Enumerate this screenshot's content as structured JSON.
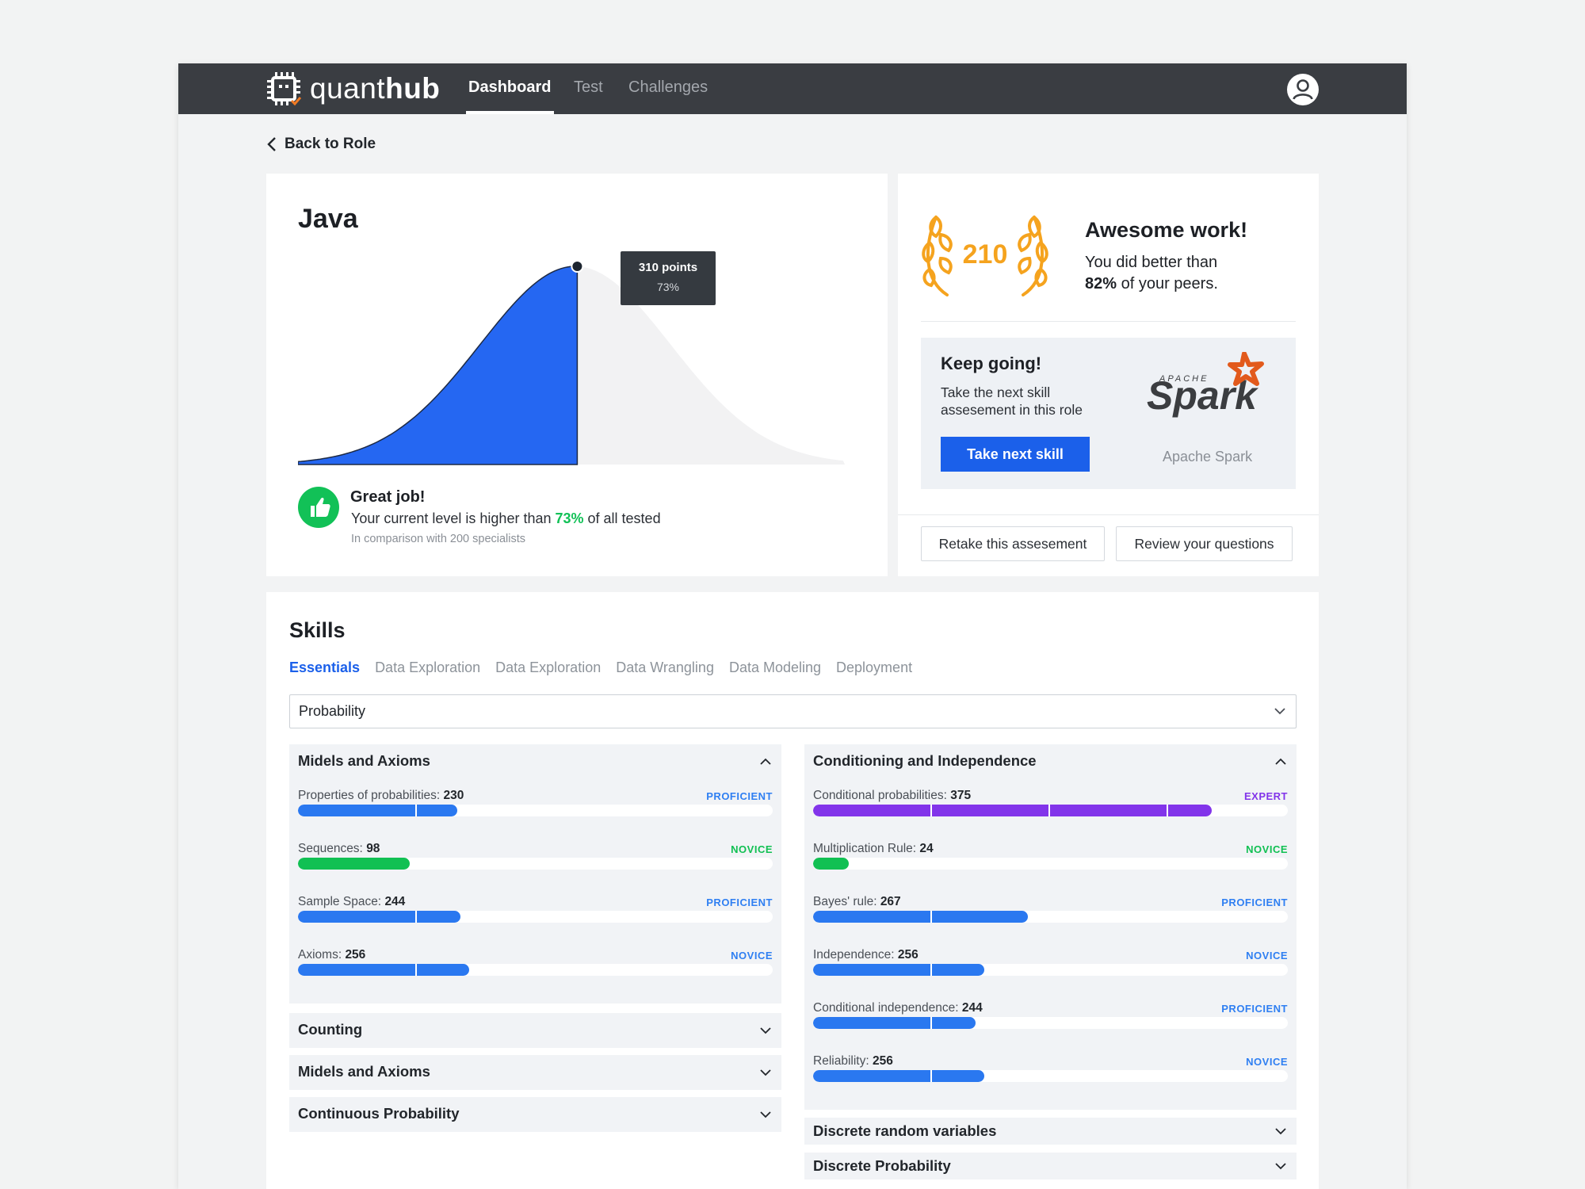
{
  "app": {
    "logo_light": "quant",
    "logo_bold": "hub",
    "nav": [
      "Dashboard",
      "Test",
      "Challenges"
    ],
    "back_label": "Back to Role"
  },
  "java_card": {
    "title": "Java",
    "tooltip_points": "310 points",
    "tooltip_pct": "73%",
    "percentile": 0.73,
    "great_title": "Great job!",
    "great_prefix": "Your current level is higher than ",
    "great_pct": "73%",
    "great_suffix": " of all tested",
    "great_note": "In comparison with 200 specialists"
  },
  "award_card": {
    "score": "210",
    "title": "Awesome work!",
    "line1": "You did better than",
    "line2_bold": "82%",
    "line2_rest": " of your peers.",
    "keep_title": "Keep going!",
    "keep_desc": "Take the next skill assesement in this role",
    "next_button": "Take next skill",
    "spark_small": "APACHE",
    "spark_big": "Spark",
    "spark_label": "Apache Spark",
    "retake_button": "Retake this assesement",
    "review_button": "Review your questions"
  },
  "skills": {
    "title": "Skills",
    "tabs": [
      "Essentials",
      "Data Exploration",
      "Data Exploration",
      "Data Wrangling",
      "Data Modeling",
      "Deployment"
    ],
    "active_tab": 0,
    "select_value": "Probability",
    "left_panel": {
      "title": "Midels and Axioms",
      "items": [
        {
          "name": "Properties of probabilities:",
          "score": "230",
          "level": "PROFICIENT",
          "fill": 0.335,
          "color": "#2a78f0",
          "lvl_class": "lvl-proficient"
        },
        {
          "name": "Sequences:",
          "score": "98",
          "level": "NOVICE",
          "fill": 0.235,
          "color": "#11c053",
          "lvl_class": "lvl-novice-green"
        },
        {
          "name": "Sample Space:",
          "score": "244",
          "level": "PROFICIENT",
          "fill": 0.343,
          "color": "#2a78f0",
          "lvl_class": "lvl-proficient"
        },
        {
          "name": "Axioms:",
          "score": "256",
          "level": "NOVICE",
          "fill": 0.36,
          "color": "#2a78f0",
          "lvl_class": "lvl-novice-blue"
        }
      ]
    },
    "left_collapsed": [
      "Counting",
      "Midels and Axioms",
      "Continuous Probability"
    ],
    "right_panel": {
      "title": "Conditioning and Independence",
      "items": [
        {
          "name": "Conditional probabilities:",
          "score": "375",
          "level": "EXPERT",
          "fill": 0.84,
          "color": "#8234ea",
          "lvl_class": "lvl-expert"
        },
        {
          "name": "Multiplication Rule:",
          "score": "24",
          "level": "NOVICE",
          "fill": 0.075,
          "color": "#11c053",
          "lvl_class": "lvl-novice-green"
        },
        {
          "name": "Bayes' rule:",
          "score": "267",
          "level": "PROFICIENT",
          "fill": 0.453,
          "color": "#2a78f0",
          "lvl_class": "lvl-proficient"
        },
        {
          "name": "Independence:",
          "score": "256",
          "level": "NOVICE",
          "fill": 0.36,
          "color": "#2a78f0",
          "lvl_class": "lvl-novice-blue"
        },
        {
          "name": "Conditional independence:",
          "score": "244",
          "level": "PROFICIENT",
          "fill": 0.343,
          "color": "#2a78f0",
          "lvl_class": "lvl-proficient"
        },
        {
          "name": "Reliability:",
          "score": "256",
          "level": "NOVICE",
          "fill": 0.36,
          "color": "#2a78f0",
          "lvl_class": "lvl-novice-blue"
        }
      ]
    },
    "right_collapsed": [
      "Discrete random variables",
      "Discrete Probability"
    ]
  },
  "colors": {
    "accent_blue": "#1b60ea",
    "curve_blue": "#2567f2",
    "success_green": "#12c157",
    "award_orange": "#f5a31e",
    "spark_orange": "#e25a1c"
  }
}
